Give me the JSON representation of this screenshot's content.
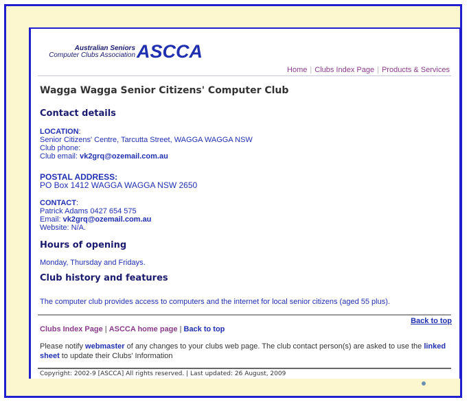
{
  "logo": {
    "line1": "Australian Seniors",
    "line2": "Computer Clubs Association",
    "abbrev": "ASCCA"
  },
  "nav": {
    "items": [
      "Home",
      "Clubs Index Page",
      "Products & Services"
    ]
  },
  "page_title": "Wagga Wagga Senior Citizens' Computer Club",
  "contact_heading": "Contact details",
  "location": {
    "label": "LOCATION",
    "address": "Senior Citizens' Centre, Tarcutta Street, WAGGA WAGGA NSW",
    "phone": "Club phone:",
    "email_label": "Club email: ",
    "email": "vk2grq@ozemail.com.au"
  },
  "postal": {
    "label": "POSTAL ADDRESS:",
    "value": "PO Box 1412 WAGGA WAGGA NSW 2650"
  },
  "contact": {
    "label": "CONTACT",
    "person": "Patrick Adams 0427 654 575",
    "email_label": "Email: ",
    "email": "vk2grq@ozemail.com.au",
    "website": "Website: N/A."
  },
  "hours": {
    "heading": "Hours of opening",
    "value": "Monday, Thursday and Fridays."
  },
  "history": {
    "heading": "Club history and features",
    "value": "The computer club provides access to computers and the internet for local senior citizens (aged 55 plus)."
  },
  "footer": {
    "back_to_top": "Back to top",
    "clubs_index": "Clubs Index Page",
    "ascca_home": "ASCCA home page",
    "back_to_top2": "Back to top",
    "notify_pre": "Please notify ",
    "webmaster": "webmaster",
    "notify_mid": " of any changes to your clubs web page. The club contact person(s) are asked to use the ",
    "linked": "linked",
    "sheet": "sheet",
    "notify_post": " to update their Clubs' Information",
    "copyright": "Copyright: 2002-9 [ASCCA] All rights reserved. | Last updated: 26 August, 2009"
  }
}
